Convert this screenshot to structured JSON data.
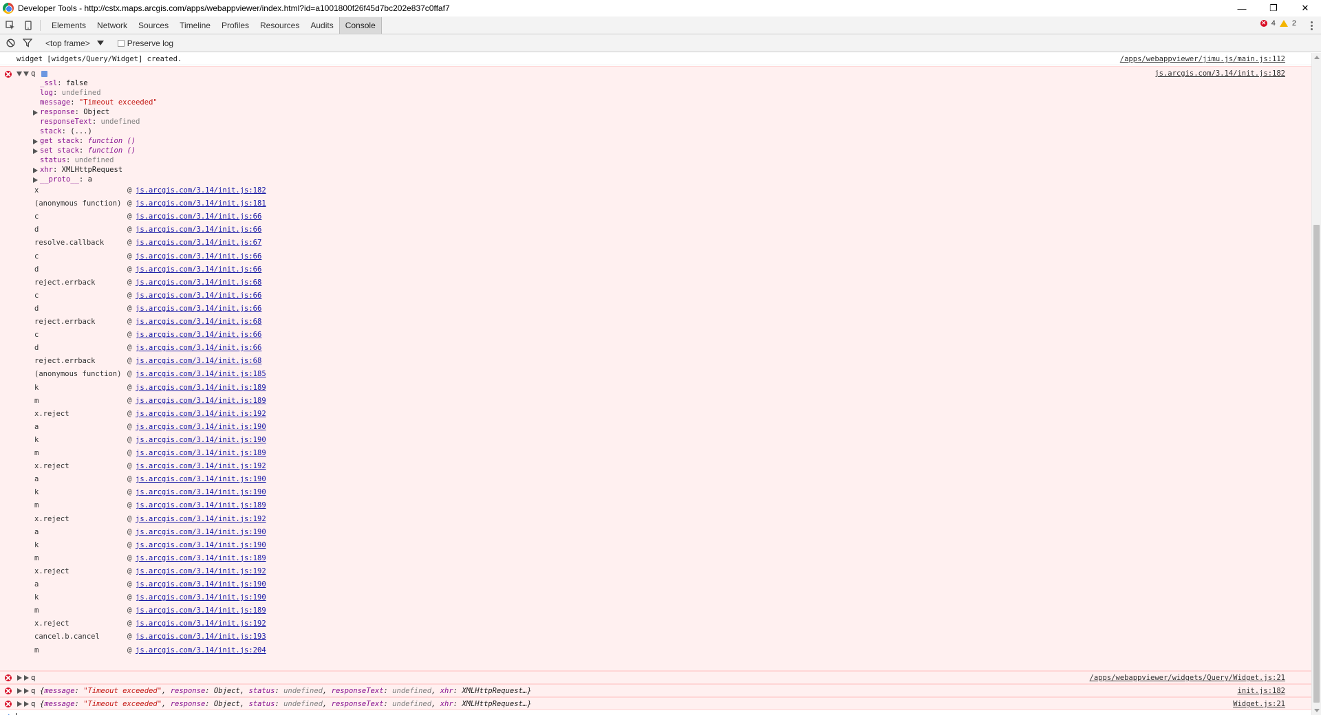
{
  "window": {
    "title": "Developer Tools - http://cstx.maps.arcgis.com/apps/webappviewer/index.html?id=a1001800f26f45d7bc202e837c0ffaf7",
    "minimize_glyph": "—",
    "restore_glyph": "❐",
    "close_glyph": "✕"
  },
  "tabs": [
    "Elements",
    "Network",
    "Sources",
    "Timeline",
    "Profiles",
    "Resources",
    "Audits",
    "Console"
  ],
  "active_tab": "Console",
  "counts": {
    "errors": "4",
    "warnings": "2"
  },
  "toolbar": {
    "frame": "<top frame>",
    "preserve_log": "Preserve log"
  },
  "console": {
    "log_line": {
      "text": "widget [widgets/Query/Widget] created.",
      "source": "/apps/webappviewer/jimu.js/main.js:112"
    },
    "error1": {
      "name": "q",
      "source": "js.arcgis.com/3.14/init.js:182",
      "props": [
        {
          "key": "_ssl",
          "sep": ": ",
          "val": "false",
          "kind": "plain",
          "arrow": false
        },
        {
          "key": "log",
          "sep": ": ",
          "val": "undefined",
          "kind": "gray",
          "arrow": false
        },
        {
          "key": "message",
          "sep": ": ",
          "val": "\"Timeout exceeded\"",
          "kind": "str",
          "arrow": false
        },
        {
          "key": "response",
          "sep": ": ",
          "val": "Object",
          "kind": "plain",
          "arrow": true
        },
        {
          "key": "responseText",
          "sep": ": ",
          "val": "undefined",
          "kind": "gray",
          "arrow": false
        },
        {
          "key": "stack",
          "sep": ": ",
          "val": "(...)",
          "kind": "plain",
          "arrow": false
        },
        {
          "key": "get stack",
          "sep": ": ",
          "val": "function ()",
          "kind": "fn",
          "arrow": true
        },
        {
          "key": "set stack",
          "sep": ": ",
          "val": "function ()",
          "kind": "fn",
          "arrow": true
        },
        {
          "key": "status",
          "sep": ": ",
          "val": "undefined",
          "kind": "gray",
          "arrow": false
        },
        {
          "key": "xhr",
          "sep": ": ",
          "val": "XMLHttpRequest",
          "kind": "plain",
          "arrow": true
        },
        {
          "key": "__proto__",
          "sep": ": ",
          "val": "a",
          "kind": "plain",
          "arrow": true
        }
      ],
      "stack": [
        {
          "fn": "x",
          "loc": "js.arcgis.com/3.14/init.js:182"
        },
        {
          "fn": "(anonymous function)",
          "loc": "js.arcgis.com/3.14/init.js:181"
        },
        {
          "fn": "c",
          "loc": "js.arcgis.com/3.14/init.js:66"
        },
        {
          "fn": "d",
          "loc": "js.arcgis.com/3.14/init.js:66"
        },
        {
          "fn": "resolve.callback",
          "loc": "js.arcgis.com/3.14/init.js:67"
        },
        {
          "fn": "c",
          "loc": "js.arcgis.com/3.14/init.js:66"
        },
        {
          "fn": "d",
          "loc": "js.arcgis.com/3.14/init.js:66"
        },
        {
          "fn": "reject.errback",
          "loc": "js.arcgis.com/3.14/init.js:68"
        },
        {
          "fn": "c",
          "loc": "js.arcgis.com/3.14/init.js:66"
        },
        {
          "fn": "d",
          "loc": "js.arcgis.com/3.14/init.js:66"
        },
        {
          "fn": "reject.errback",
          "loc": "js.arcgis.com/3.14/init.js:68"
        },
        {
          "fn": "c",
          "loc": "js.arcgis.com/3.14/init.js:66"
        },
        {
          "fn": "d",
          "loc": "js.arcgis.com/3.14/init.js:66"
        },
        {
          "fn": "reject.errback",
          "loc": "js.arcgis.com/3.14/init.js:68"
        },
        {
          "fn": "(anonymous function)",
          "loc": "js.arcgis.com/3.14/init.js:185"
        },
        {
          "fn": "k",
          "loc": "js.arcgis.com/3.14/init.js:189"
        },
        {
          "fn": "m",
          "loc": "js.arcgis.com/3.14/init.js:189"
        },
        {
          "fn": "x.reject",
          "loc": "js.arcgis.com/3.14/init.js:192"
        },
        {
          "fn": "a",
          "loc": "js.arcgis.com/3.14/init.js:190"
        },
        {
          "fn": "k",
          "loc": "js.arcgis.com/3.14/init.js:190"
        },
        {
          "fn": "m",
          "loc": "js.arcgis.com/3.14/init.js:189"
        },
        {
          "fn": "x.reject",
          "loc": "js.arcgis.com/3.14/init.js:192"
        },
        {
          "fn": "a",
          "loc": "js.arcgis.com/3.14/init.js:190"
        },
        {
          "fn": "k",
          "loc": "js.arcgis.com/3.14/init.js:190"
        },
        {
          "fn": "m",
          "loc": "js.arcgis.com/3.14/init.js:189"
        },
        {
          "fn": "x.reject",
          "loc": "js.arcgis.com/3.14/init.js:192"
        },
        {
          "fn": "a",
          "loc": "js.arcgis.com/3.14/init.js:190"
        },
        {
          "fn": "k",
          "loc": "js.arcgis.com/3.14/init.js:190"
        },
        {
          "fn": "m",
          "loc": "js.arcgis.com/3.14/init.js:189"
        },
        {
          "fn": "x.reject",
          "loc": "js.arcgis.com/3.14/init.js:192"
        },
        {
          "fn": "a",
          "loc": "js.arcgis.com/3.14/init.js:190"
        },
        {
          "fn": "k",
          "loc": "js.arcgis.com/3.14/init.js:190"
        },
        {
          "fn": "m",
          "loc": "js.arcgis.com/3.14/init.js:189"
        },
        {
          "fn": "x.reject",
          "loc": "js.arcgis.com/3.14/init.js:192"
        },
        {
          "fn": "cancel.b.cancel",
          "loc": "js.arcgis.com/3.14/init.js:193"
        },
        {
          "fn": "m",
          "loc": "js.arcgis.com/3.14/init.js:204"
        }
      ]
    },
    "error2": {
      "name": "q",
      "source": "/apps/webappviewer/widgets/Query/Widget.js:21"
    },
    "error3": {
      "name": "q",
      "source": "init.js:182"
    },
    "error4": {
      "name": "q",
      "source": "Widget.js:21"
    },
    "summary_parts": [
      {
        "t": "{",
        "k": "plain"
      },
      {
        "t": "message",
        "k": "key"
      },
      {
        "t": ": ",
        "k": "plain"
      },
      {
        "t": "\"Timeout exceeded\"",
        "k": "str"
      },
      {
        "t": ", ",
        "k": "plain"
      },
      {
        "t": "response",
        "k": "key"
      },
      {
        "t": ": Object, ",
        "k": "plain"
      },
      {
        "t": "status",
        "k": "key"
      },
      {
        "t": ": ",
        "k": "plain"
      },
      {
        "t": "undefined",
        "k": "gray"
      },
      {
        "t": ", ",
        "k": "plain"
      },
      {
        "t": "responseText",
        "k": "key"
      },
      {
        "t": ": ",
        "k": "plain"
      },
      {
        "t": "undefined",
        "k": "gray"
      },
      {
        "t": ", ",
        "k": "plain"
      },
      {
        "t": "xhr",
        "k": "key"
      },
      {
        "t": ": XMLHttpRequest…}",
        "k": "plain"
      }
    ],
    "at_symbol": "@",
    "prompt": "›"
  },
  "colors": {
    "error": "#d80c24",
    "warning": "#f4b400",
    "link": "#1a1aa6",
    "error_bg": "#fff0f0"
  },
  "icons": {
    "inspect": "inspect-element-icon",
    "device": "device-mode-icon",
    "clear": "clear-console-icon",
    "filter": "filter-icon",
    "error": "error-icon",
    "warning": "warning-icon",
    "menu": "more-menu-icon"
  }
}
